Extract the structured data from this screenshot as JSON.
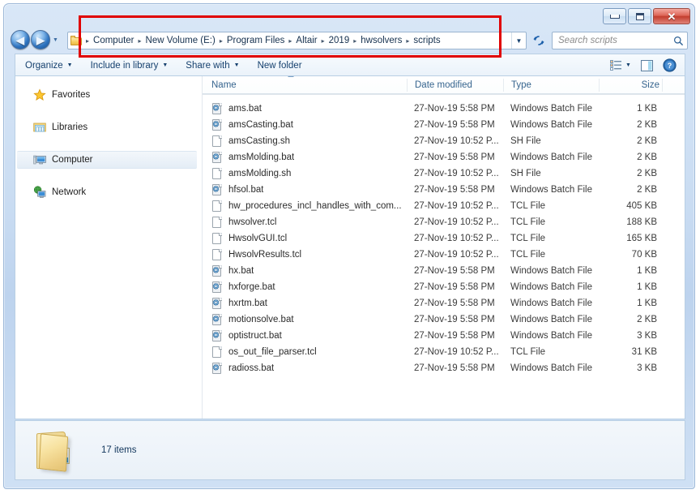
{
  "window": {
    "controls": {
      "minimize_label": "Minimize",
      "maximize_label": "Maximize",
      "close_label": "Close",
      "close_glyph": "✕"
    }
  },
  "navbar": {
    "back_label": "Back",
    "back_glyph": "◀",
    "forward_label": "Forward",
    "forward_glyph": "▶",
    "history_caret": "▼",
    "address": {
      "breadcrumbs": [
        "Computer",
        "New Volume (E:)",
        "Program Files",
        "Altair",
        "2019",
        "hwsolvers",
        "scripts"
      ],
      "separator": "▸",
      "dropdown_caret": "▼"
    },
    "refresh_label": "Refresh",
    "search": {
      "placeholder": "Search scripts",
      "icon": "search-icon"
    }
  },
  "toolbar": {
    "items": [
      {
        "label": "Organize",
        "caret": "▼"
      },
      {
        "label": "Include in library",
        "caret": "▼"
      },
      {
        "label": "Share with",
        "caret": "▼"
      },
      {
        "label": "New folder",
        "caret": ""
      }
    ],
    "view_button": "change-view",
    "view_caret": "▼",
    "preview_button": "show-preview-pane",
    "help_button": "help",
    "help_glyph": "?"
  },
  "nav_pane": {
    "items": [
      {
        "label": "Favorites",
        "icon": "star-icon",
        "selected": false
      },
      {
        "label": "Libraries",
        "icon": "libraries-icon",
        "selected": false
      },
      {
        "label": "Computer",
        "icon": "computer-icon",
        "selected": true
      },
      {
        "label": "Network",
        "icon": "network-icon",
        "selected": false
      }
    ]
  },
  "file_list": {
    "columns": [
      "Name",
      "Date modified",
      "Type",
      "Size"
    ],
    "sorted_by": "Name",
    "sort_direction": "ascending",
    "rows": [
      {
        "name": "ams.bat",
        "date": "27-Nov-19 5:58 PM",
        "type": "Windows Batch File",
        "size": "1 KB",
        "icon": "batch-file-icon"
      },
      {
        "name": "amsCasting.bat",
        "date": "27-Nov-19 5:58 PM",
        "type": "Windows Batch File",
        "size": "2 KB",
        "icon": "batch-file-icon"
      },
      {
        "name": "amsCasting.sh",
        "date": "27-Nov-19 10:52 P...",
        "type": "SH File",
        "size": "2 KB",
        "icon": "generic-file-icon"
      },
      {
        "name": "amsMolding.bat",
        "date": "27-Nov-19 5:58 PM",
        "type": "Windows Batch File",
        "size": "2 KB",
        "icon": "batch-file-icon"
      },
      {
        "name": "amsMolding.sh",
        "date": "27-Nov-19 10:52 P...",
        "type": "SH File",
        "size": "2 KB",
        "icon": "generic-file-icon"
      },
      {
        "name": "hfsol.bat",
        "date": "27-Nov-19 5:58 PM",
        "type": "Windows Batch File",
        "size": "2 KB",
        "icon": "batch-file-icon"
      },
      {
        "name": "hw_procedures_incl_handles_with_com...",
        "date": "27-Nov-19 10:52 P...",
        "type": "TCL File",
        "size": "405 KB",
        "icon": "generic-file-icon"
      },
      {
        "name": "hwsolver.tcl",
        "date": "27-Nov-19 10:52 P...",
        "type": "TCL File",
        "size": "188 KB",
        "icon": "generic-file-icon"
      },
      {
        "name": "HwsolvGUI.tcl",
        "date": "27-Nov-19 10:52 P...",
        "type": "TCL File",
        "size": "165 KB",
        "icon": "generic-file-icon"
      },
      {
        "name": "HwsolvResults.tcl",
        "date": "27-Nov-19 10:52 P...",
        "type": "TCL File",
        "size": "70 KB",
        "icon": "generic-file-icon"
      },
      {
        "name": "hx.bat",
        "date": "27-Nov-19 5:58 PM",
        "type": "Windows Batch File",
        "size": "1 KB",
        "icon": "batch-file-icon"
      },
      {
        "name": "hxforge.bat",
        "date": "27-Nov-19 5:58 PM",
        "type": "Windows Batch File",
        "size": "1 KB",
        "icon": "batch-file-icon"
      },
      {
        "name": "hxrtm.bat",
        "date": "27-Nov-19 5:58 PM",
        "type": "Windows Batch File",
        "size": "1 KB",
        "icon": "batch-file-icon"
      },
      {
        "name": "motionsolve.bat",
        "date": "27-Nov-19 5:58 PM",
        "type": "Windows Batch File",
        "size": "2 KB",
        "icon": "batch-file-icon"
      },
      {
        "name": "optistruct.bat",
        "date": "27-Nov-19 5:58 PM",
        "type": "Windows Batch File",
        "size": "3 KB",
        "icon": "batch-file-icon"
      },
      {
        "name": "os_out_file_parser.tcl",
        "date": "27-Nov-19 10:52 P...",
        "type": "TCL File",
        "size": "31 KB",
        "icon": "generic-file-icon"
      },
      {
        "name": "radioss.bat",
        "date": "27-Nov-19 5:58 PM",
        "type": "Windows Batch File",
        "size": "3 KB",
        "icon": "batch-file-icon"
      }
    ]
  },
  "status_bar": {
    "item_count": "17 items",
    "folder_icon": "folder-icon"
  },
  "annotation": {
    "color": "#e00000",
    "shape": "rectangle",
    "target": "address-bar"
  }
}
